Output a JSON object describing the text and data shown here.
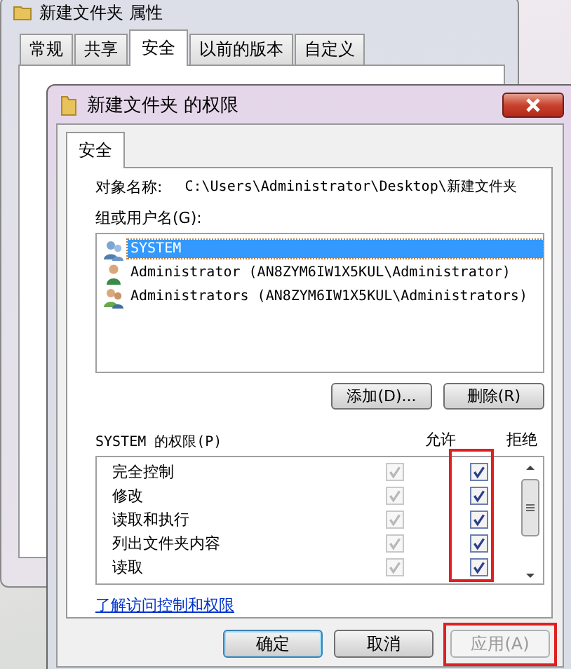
{
  "back_window": {
    "title": "新建文件夹 属性",
    "tabs": [
      {
        "label": "常规",
        "selected": false
      },
      {
        "label": "共享",
        "selected": false
      },
      {
        "label": "安全",
        "selected": true
      },
      {
        "label": "以前的版本",
        "selected": false
      },
      {
        "label": "自定义",
        "selected": false
      }
    ]
  },
  "dialog": {
    "title": "新建文件夹 的权限",
    "tabs": [
      {
        "label": "安全",
        "selected": true
      }
    ],
    "object_label": "对象名称:",
    "object_value": "C:\\Users\\Administrator\\Desktop\\新建文件夹",
    "group_label": "组或用户名(G):",
    "users": [
      {
        "name": "SYSTEM",
        "kind": "system",
        "selected": true
      },
      {
        "name": "Administrator (AN8ZYM6IW1X5KUL\\Administrator)",
        "kind": "user",
        "selected": false
      },
      {
        "name": "Administrators (AN8ZYM6IW1X5KUL\\Administrators)",
        "kind": "group",
        "selected": false
      }
    ],
    "user_buttons": [
      "添加(D)...",
      "删除(R)"
    ],
    "permissions_label": "SYSTEM 的权限(P)",
    "allow_label": "允许",
    "deny_label": "拒绝",
    "deny_highlighted": true,
    "permissions": [
      {
        "name": "完全控制",
        "allow": true,
        "allow_disabled": true,
        "deny": true
      },
      {
        "name": "修改",
        "allow": true,
        "allow_disabled": true,
        "deny": true
      },
      {
        "name": "读取和执行",
        "allow": true,
        "allow_disabled": true,
        "deny": true
      },
      {
        "name": "列出文件夹内容",
        "allow": true,
        "allow_disabled": true,
        "deny": true
      },
      {
        "name": "读取",
        "allow": true,
        "allow_disabled": true,
        "deny": true
      }
    ],
    "link": "了解访问控制和权限",
    "buttons": [
      {
        "label": "确定",
        "default": true,
        "disabled": false,
        "highlighted": false
      },
      {
        "label": "取消",
        "default": false,
        "disabled": false,
        "highlighted": false
      },
      {
        "label": "应用(A)",
        "default": false,
        "disabled": true,
        "highlighted": true
      }
    ]
  }
}
